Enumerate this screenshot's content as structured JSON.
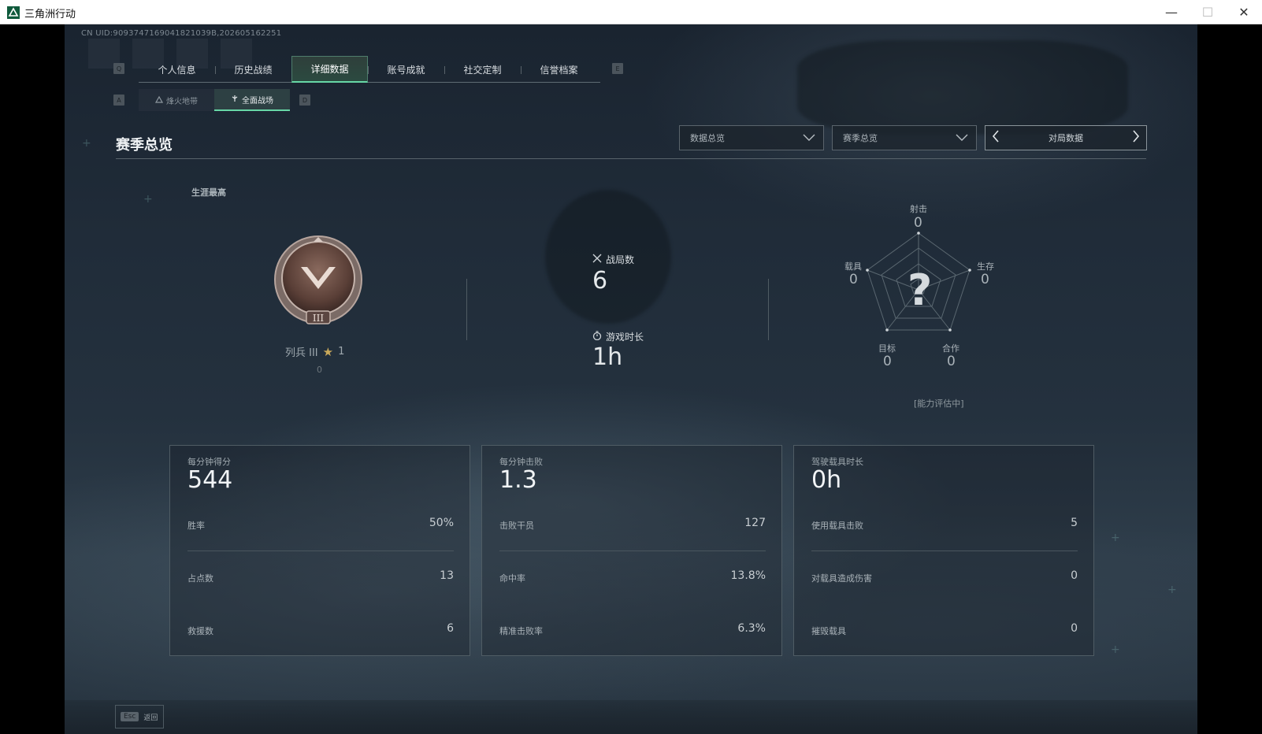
{
  "window": {
    "title": "三角洲行动",
    "minimize": "—",
    "maximize": "☐",
    "close": "✕"
  },
  "uid_text": "CN UID:9093747169041821039B,202605162251",
  "key_hints": {
    "tab_prev": "Q",
    "tab_next": "E",
    "sub_prev": "A",
    "sub_next": "D"
  },
  "tabs": [
    {
      "label": "个人信息",
      "active": false
    },
    {
      "label": "历史战绩",
      "active": false
    },
    {
      "label": "详细数据",
      "active": true
    },
    {
      "label": "账号成就",
      "active": false
    },
    {
      "label": "社交定制",
      "active": false
    },
    {
      "label": "信誉档案",
      "active": false
    }
  ],
  "subtabs": [
    {
      "label": "烽火地带",
      "icon": "mountain-icon",
      "active": false
    },
    {
      "label": "全面战场",
      "icon": "battlefield-icon",
      "active": true
    }
  ],
  "section": {
    "title": "赛季总览"
  },
  "filters": {
    "data_dropdown": "数据总览",
    "season_dropdown": "赛季总览",
    "pager_label": "对局数据"
  },
  "career": {
    "label": "生涯最高",
    "rank_name": "列兵 III",
    "rank_stars": "1",
    "rank_points": "0"
  },
  "match_stats": {
    "matches_label": "战局数",
    "matches_value": "6",
    "playtime_label": "游戏时长",
    "playtime_value": "1h"
  },
  "radar": {
    "shooting_label": "射击",
    "shooting_value": "0",
    "survival_label": "生存",
    "survival_value": "0",
    "vehicle_label": "载具",
    "vehicle_value": "0",
    "objective_label": "目标",
    "objective_value": "0",
    "teamwork_label": "合作",
    "teamwork_value": "0",
    "center_glyph": "?",
    "note": "[能力评估中]"
  },
  "cards": [
    {
      "title": "每分钟得分",
      "big": "544",
      "rows": [
        {
          "label": "胜率",
          "value": "50%"
        },
        {
          "label": "占点数",
          "value": "13"
        },
        {
          "label": "救援数",
          "value": "6"
        }
      ]
    },
    {
      "title": "每分钟击败",
      "big": "1.3",
      "rows": [
        {
          "label": "击败干员",
          "value": "127"
        },
        {
          "label": "命中率",
          "value": "13.8%"
        },
        {
          "label": "精准击败率",
          "value": "6.3%"
        }
      ]
    },
    {
      "title": "驾驶载具时长",
      "big": "0h",
      "rows": [
        {
          "label": "使用载具击败",
          "value": "5"
        },
        {
          "label": "对载具造成伤害",
          "value": "0"
        },
        {
          "label": "摧毁载具",
          "value": "0"
        }
      ]
    }
  ],
  "footer": {
    "esc_key": "Esc",
    "esc_label": "返回"
  },
  "colors": {
    "accent": "#67d7a6",
    "background": "#222d38",
    "text": "#e4e8ea"
  }
}
